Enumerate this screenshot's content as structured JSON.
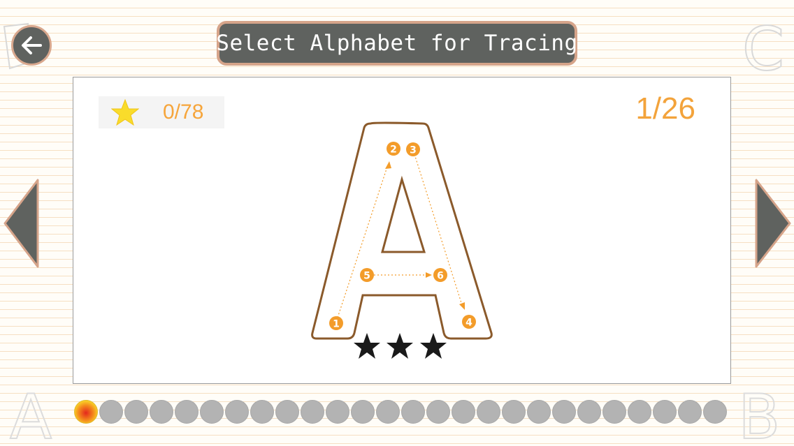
{
  "header": {
    "title": "Select Alphabet for Tracing",
    "back_icon": "arrow-left-icon"
  },
  "score": {
    "icon": "star-icon",
    "value": "0/78"
  },
  "pager": {
    "current": 1,
    "total": 26,
    "label": "1/26"
  },
  "letter": {
    "glyph": "A",
    "strokes": [
      {
        "number": "1",
        "from": "2",
        "label_start": "1",
        "label_end": "2"
      },
      {
        "number": "2"
      },
      {
        "number": "3"
      },
      {
        "number": "4"
      },
      {
        "number": "5"
      },
      {
        "number": "6"
      }
    ]
  },
  "rating": {
    "stars_total": 3,
    "stars_earned": 0
  },
  "progress": {
    "count": 26,
    "active_index": 0
  },
  "decorations": {
    "top_left": "",
    "top_right": "C",
    "bottom_left": "A",
    "bottom_right": "B"
  },
  "colors": {
    "accent": "#f6a53b",
    "outline": "#8b5a2b",
    "button_bg": "#5f625f",
    "button_border": "#d6a48a"
  }
}
